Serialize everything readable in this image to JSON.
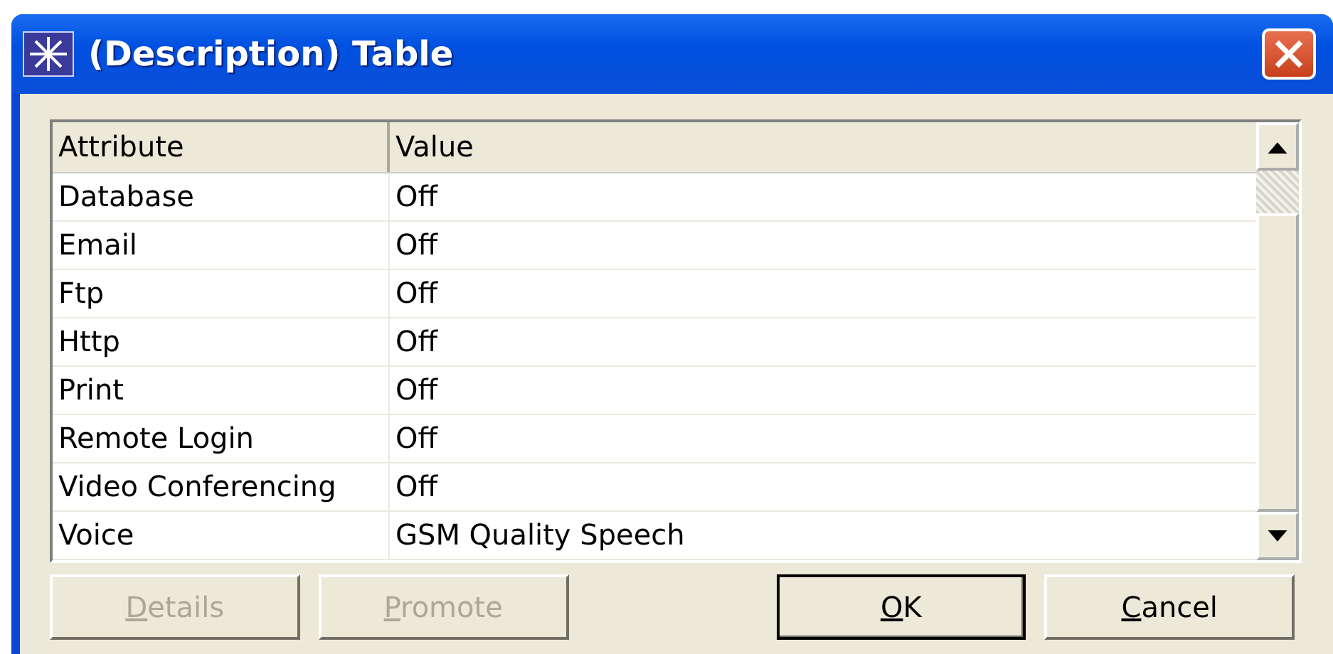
{
  "window": {
    "title": "(Description) Table"
  },
  "table": {
    "columns": [
      "Attribute",
      "Value"
    ],
    "rows": [
      {
        "attribute": "Database",
        "value": "Off"
      },
      {
        "attribute": "Email",
        "value": "Off"
      },
      {
        "attribute": "Ftp",
        "value": "Off"
      },
      {
        "attribute": "Http",
        "value": "Off"
      },
      {
        "attribute": "Print",
        "value": "Off"
      },
      {
        "attribute": "Remote Login",
        "value": "Off"
      },
      {
        "attribute": "Video Conferencing",
        "value": "Off"
      },
      {
        "attribute": "Voice",
        "value": "GSM Quality Speech"
      }
    ]
  },
  "buttons": [
    {
      "label": "Details",
      "disabled": true,
      "default": false,
      "underline_first": true
    },
    {
      "label": "Promote",
      "disabled": true,
      "default": false,
      "underline_first": true
    },
    {
      "label": "OK",
      "disabled": false,
      "default": true,
      "underline_first": true
    },
    {
      "label": "Cancel",
      "disabled": false,
      "default": false,
      "underline_first": true
    }
  ]
}
